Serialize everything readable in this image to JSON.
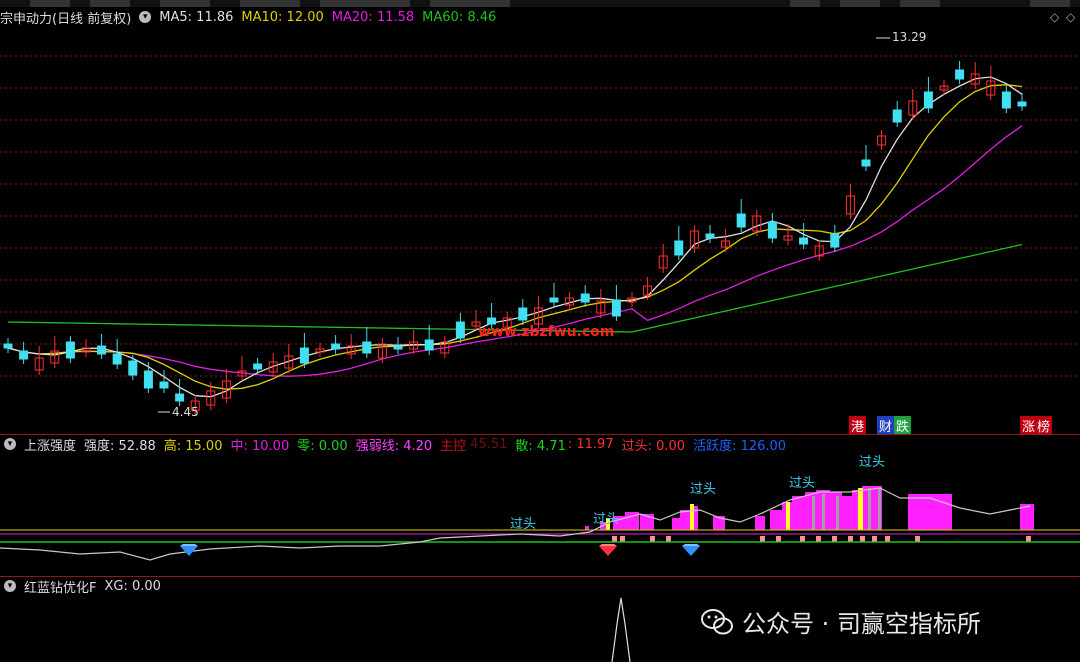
{
  "main": {
    "stock_title": "宗申动力(日线 前复权)",
    "ma5": "MA5: 11.86",
    "ma10": "MA10: 12.00",
    "ma20": "MA20: 11.58",
    "ma60": "MA60: 8.46",
    "high_label": "13.29",
    "low_label": "4.45",
    "site_watermark": "www.zbzfwu.com",
    "badges": [
      "港",
      "财",
      "跌",
      "涨",
      "榜"
    ],
    "colors": {
      "ma5": "#e0e0e0",
      "ma10": "#e0d000",
      "ma20": "#e020e0",
      "ma60": "#20c020",
      "up": "#ff3030",
      "down": "#40e0f0"
    }
  },
  "indicator1": {
    "name": "上涨强度",
    "strength": "强度: 52.88",
    "high": "高: 15.00",
    "mid": "中: 10.00",
    "zero": "零: 0.00",
    "strong_weak": "强弱线: 4.20",
    "main_ctrl": "主控",
    "main_ctrl_val": "45.51",
    "scatter": "散: 4.71",
    "extra": ": 11.97",
    "overhead": "过头: 0.00",
    "activity": "活跃度: 126.00",
    "guotou_labels": [
      "过头",
      "过头",
      "过头",
      "过头",
      "过头"
    ]
  },
  "indicator2": {
    "name": "红蓝钻优化F",
    "xg": "XG: 0.00"
  },
  "watermark": {
    "text": "公众号 · 司赢空指标所"
  }
}
